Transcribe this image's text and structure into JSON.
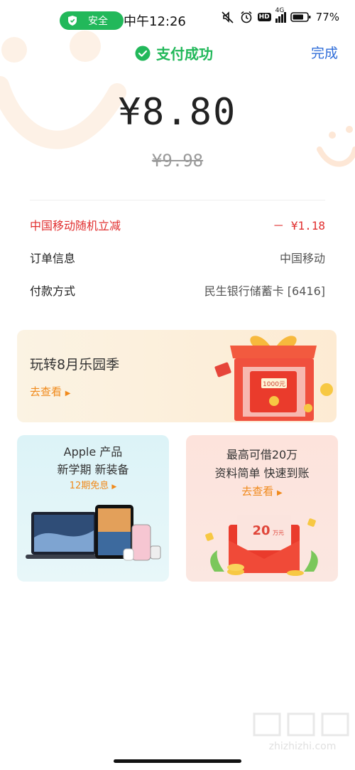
{
  "status_bar": {
    "security_label": "安全",
    "time": "中午12:26",
    "network": "4G",
    "hd": "HD",
    "battery": "77%"
  },
  "header": {
    "status_title": "支付成功",
    "done_label": "完成"
  },
  "payment": {
    "amount": "¥8.80",
    "original_amount": "¥9.98"
  },
  "details": [
    {
      "label": "中国移动随机立减",
      "value": "－ ¥1.18"
    },
    {
      "label": "订单信息",
      "value": "中国移动"
    },
    {
      "label": "付款方式",
      "value": "民生银行储蓄卡 [6416]"
    }
  ],
  "banner": {
    "title": "玩转8月乐园季",
    "link": "去查看",
    "gift_text": "1000元"
  },
  "cards": {
    "left": {
      "line1": "Apple 产品",
      "line2": "新学期 新装备",
      "link": "12期免息"
    },
    "right": {
      "line1": "最高可借20万",
      "line2": "资料简单  快速到账",
      "link": "去查看",
      "envelope_amount": "20",
      "envelope_unit": "万元"
    }
  },
  "watermark": "zhizhizhi.com",
  "colors": {
    "green": "#22b85a",
    "red": "#e12f2f",
    "blue": "#2f6dd9",
    "orange": "#f08a1c"
  }
}
